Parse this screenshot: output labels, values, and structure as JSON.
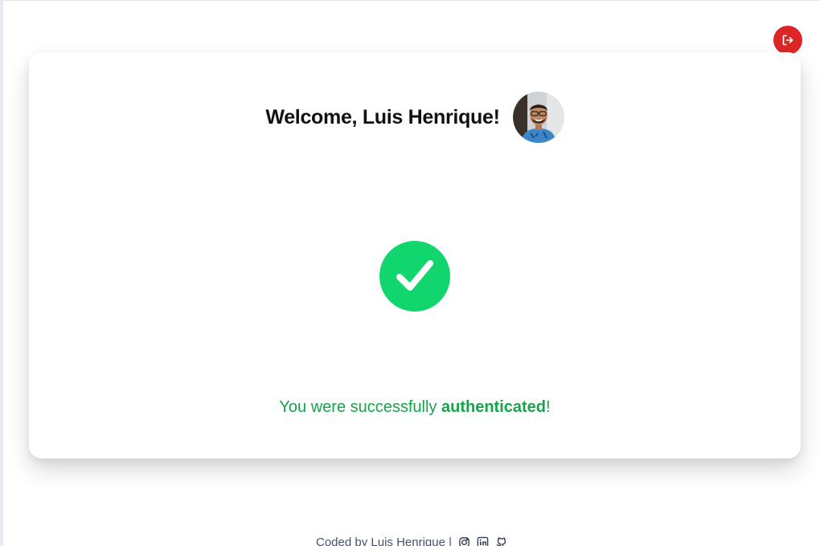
{
  "header": {
    "logout_icon": "logout-icon",
    "logout_color": "#dc2626"
  },
  "card": {
    "welcome_text": "Welcome, Luis Henrique!",
    "avatar": "user-avatar",
    "status_icon": "check-circle-icon",
    "status_color": "#16a34a",
    "success": {
      "prefix": "You were successfully ",
      "emphasis": "authenticated",
      "suffix": "!"
    }
  },
  "footer": {
    "credit": "Coded by Luis Henrique |",
    "icons": [
      "instagram-icon",
      "linkedin-icon",
      "github-icon"
    ]
  }
}
